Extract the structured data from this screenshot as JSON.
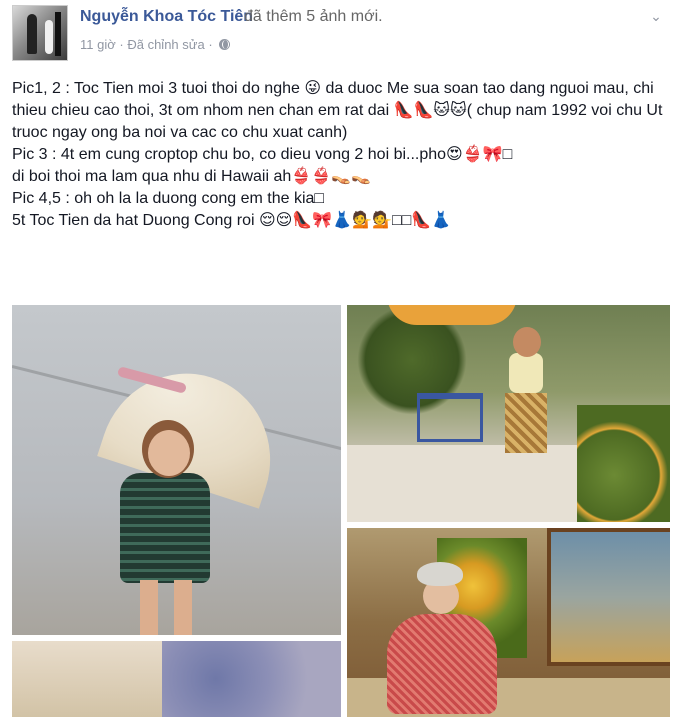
{
  "post": {
    "author": "Nguyễn Khoa Tóc Tiên",
    "action": "đã thêm 5 ảnh mới.",
    "time": "11 giờ",
    "separator": "·",
    "edited": "Đã chỉnh sửa",
    "separator2": "·",
    "privacy_icon": "globe-icon",
    "menu_icon": "chevron-down-icon"
  },
  "text": {
    "line1": "Pic1, 2 : Toc Tien moi 3 tuoi thoi do nghe 😜 da duoc Me sua soan tao dang nguoi mau, chi thieu chieu cao thoi, 3t om nhom nen chan em rat dai 👠👠🐱🐱( chup nam 1992 voi chu Ut truoc ngay ong ba noi va cac co chu xuat canh)",
    "line2": "Pic 3 : 4t em cung croptop chu bo, co dieu vong 2 hoi bi...pho😍👙🎀□",
    "line3": "di boi thoi ma lam qua nhu di Hawaii ah👙👙👡👡",
    "line4": "Pic 4,5 : oh oh la la duong cong em the kia□",
    "line5": "5t Toc Tien da hat Duong Cong roi 😌😌👠🎀👗💁💁□□👠👗"
  },
  "photos": [
    {
      "name": "photo-1"
    },
    {
      "name": "photo-2"
    },
    {
      "name": "photo-3"
    },
    {
      "name": "photo-4"
    }
  ],
  "colors": {
    "author": "#3b5998",
    "meta": "#9197a3",
    "text": "#141823",
    "background": "#ffffff"
  }
}
